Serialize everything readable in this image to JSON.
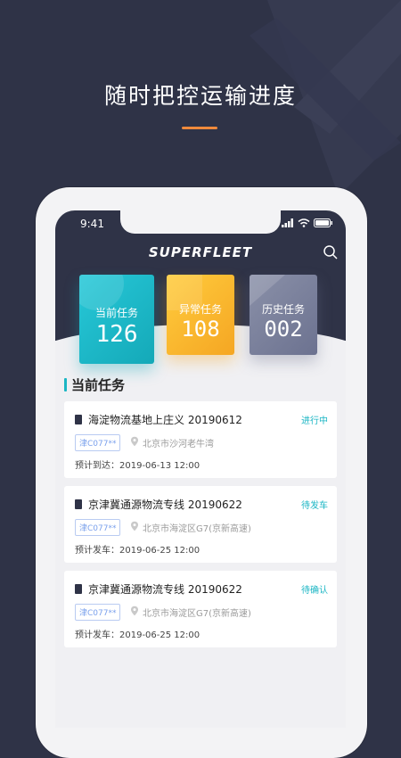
{
  "headline": "随时把控运输进度",
  "phone": {
    "time": "9:41",
    "brand": "SUPERFLEET"
  },
  "cards": {
    "current": {
      "label": "当前任务",
      "count": "126"
    },
    "abnormal": {
      "label": "异常任务",
      "count": "108"
    },
    "history": {
      "label": "历史任务",
      "count": "002"
    }
  },
  "section_title": "当前任务",
  "tasks": [
    {
      "title": "海淀物流基地上庄义  20190612",
      "status": "进行中",
      "status_color": "#1bb6c4",
      "plate": "津C077**",
      "location": "北京市沙河老牛湾",
      "eta": "预计到达：2019-06-13  12:00"
    },
    {
      "title": "京津冀通源物流专线 20190622",
      "status": "待发车",
      "status_color": "#1bb6c4",
      "plate": "津C077**",
      "location": "北京市海淀区G7(京新高速)",
      "eta": "预计发车：2019-06-25  12:00"
    },
    {
      "title": "京津冀通源物流专线 20190622",
      "status": "待确认",
      "status_color": "#1bb6c4",
      "plate": "津C077**",
      "location": "北京市海淀区G7(京新高速)",
      "eta": "预计发车：2019-06-25  12:00"
    }
  ],
  "icons": {
    "search": "search-icon",
    "signal": "signal-icon",
    "wifi": "wifi-icon",
    "battery": "battery-icon",
    "location": "location-pin-icon",
    "task": "document-icon"
  },
  "colors": {
    "background": "#2f3347",
    "accent_orange": "#f08a3c",
    "teal": "#1bb6c4",
    "amber": "#f5a623",
    "slate": "#6c7290"
  }
}
